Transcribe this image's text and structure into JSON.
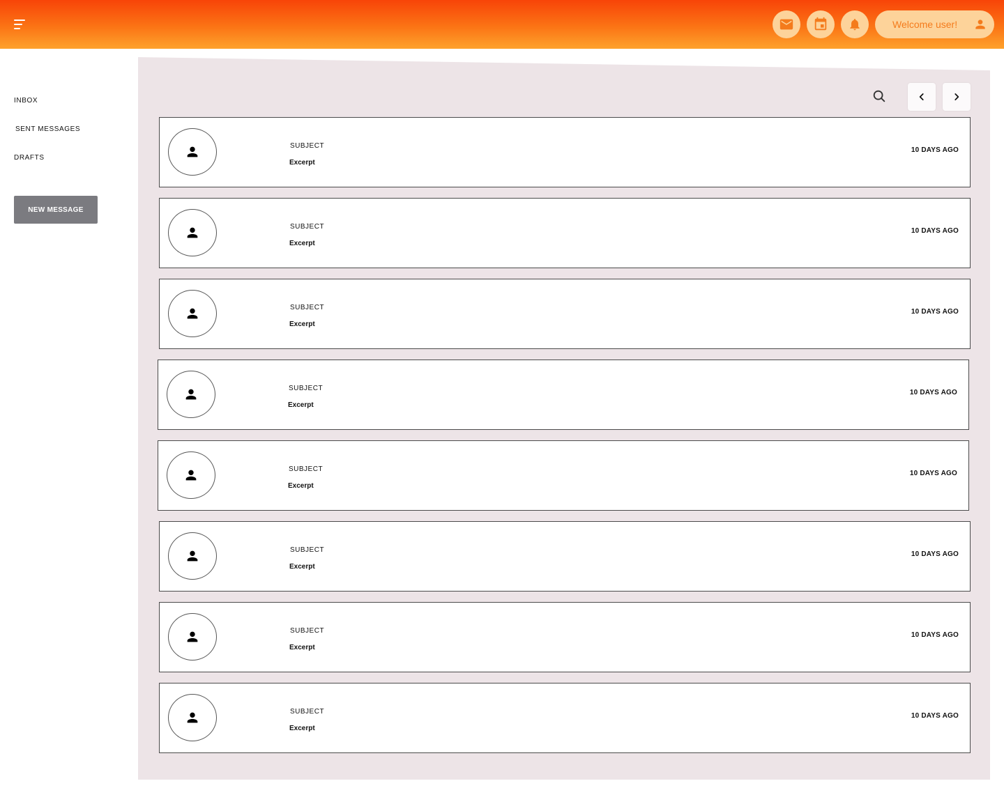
{
  "header": {
    "welcome_text": "Welcome user!",
    "brand_gradient": [
      "#f84408",
      "#fb7415",
      "#fea22c"
    ],
    "icon_bg": "#fdd39a",
    "icon_color": "#f47b1c",
    "icons": [
      "menu-icon",
      "mail-icon",
      "calendar-icon",
      "bell-icon",
      "user-icon"
    ]
  },
  "sidebar": {
    "items": [
      {
        "label": "INBOX"
      },
      {
        "label": "SENT MESSAGES"
      },
      {
        "label": "DRAFTS"
      }
    ],
    "new_message_label": "NEW MESSAGE"
  },
  "toolbar": {
    "icons": [
      "search-icon",
      "chevron-left-icon",
      "chevron-right-icon"
    ]
  },
  "messages": [
    {
      "subject": "SUBJECT",
      "excerpt": "Excerpt",
      "time": "10 DAYS AGO"
    },
    {
      "subject": "SUBJECT",
      "excerpt": "Excerpt",
      "time": "10 DAYS AGO"
    },
    {
      "subject": "SUBJECT",
      "excerpt": "Excerpt",
      "time": "10 DAYS AGO"
    },
    {
      "subject": "SUBJECT",
      "excerpt": "Excerpt",
      "time": "10 DAYS AGO"
    },
    {
      "subject": "SUBJECT",
      "excerpt": "Excerpt",
      "time": "10 DAYS AGO"
    },
    {
      "subject": "SUBJECT",
      "excerpt": "Excerpt",
      "time": "10 DAYS AGO"
    },
    {
      "subject": "SUBJECT",
      "excerpt": "Excerpt",
      "time": "10 DAYS AGO"
    },
    {
      "subject": "SUBJECT",
      "excerpt": "Excerpt",
      "time": "10 DAYS AGO"
    }
  ],
  "colors": {
    "panel_bg": "#ede4e7",
    "button_bg": "#7b7b80"
  }
}
